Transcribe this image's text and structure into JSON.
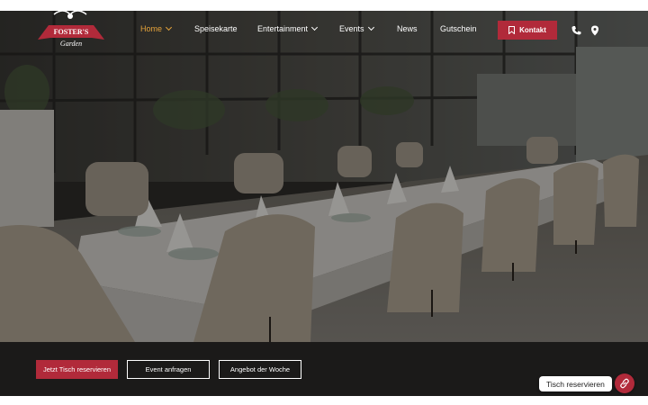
{
  "brand": {
    "logo_line1": "FOSTER'S",
    "logo_line2": "Garden"
  },
  "nav": {
    "items": [
      {
        "label": "Home",
        "active": true,
        "has_dropdown": true
      },
      {
        "label": "Speisekarte",
        "active": false,
        "has_dropdown": false
      },
      {
        "label": "Entertainment",
        "active": false,
        "has_dropdown": true
      },
      {
        "label": "Events",
        "active": false,
        "has_dropdown": true
      },
      {
        "label": "News",
        "active": false,
        "has_dropdown": false
      },
      {
        "label": "Gutschein",
        "active": false,
        "has_dropdown": false
      }
    ],
    "kontakt_label": "Kontakt",
    "icons": [
      "bookmark-icon",
      "phone-icon",
      "map-pin-icon"
    ]
  },
  "hero": {
    "description_icon": "restaurant-photo"
  },
  "actions": {
    "reserve_label": "Jetzt Tisch reservieren",
    "event_label": "Event anfragen",
    "offer_label": "Angebot der Woche"
  },
  "widget": {
    "label": "Tisch reservieren",
    "icon": "link-icon"
  },
  "colors": {
    "accent": "#b12a3a",
    "active_nav": "#e4a23a",
    "bar": "#1b1a19"
  }
}
